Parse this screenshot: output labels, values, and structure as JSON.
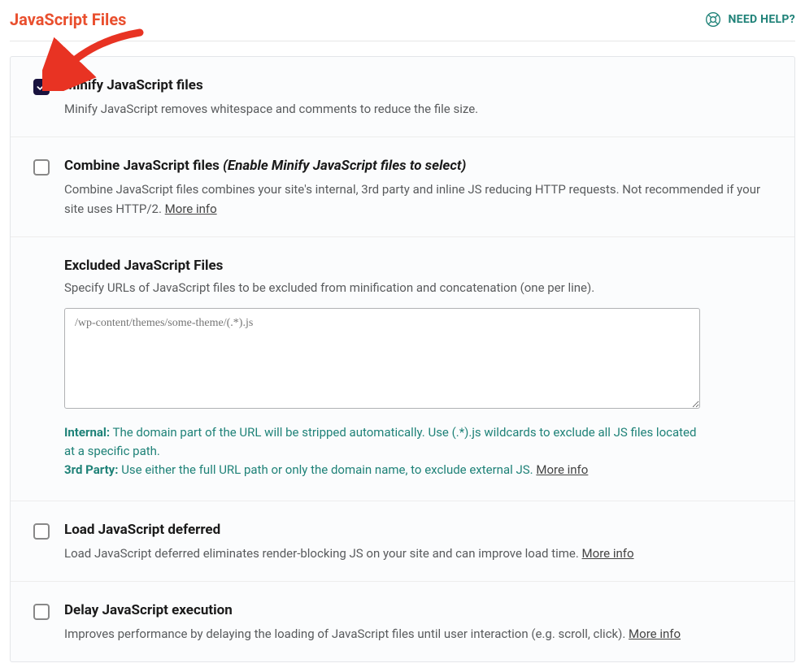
{
  "header": {
    "title": "JavaScript Files",
    "help_label": "NEED HELP?"
  },
  "options": {
    "minify": {
      "title": "Minify JavaScript files",
      "desc": "Minify JavaScript removes whitespace and comments to reduce the file size.",
      "checked": true
    },
    "combine": {
      "title": "Combine JavaScript files",
      "note": "(Enable Minify JavaScript files to select)",
      "desc": "Combine JavaScript files combines your site's internal, 3rd party and inline JS reducing HTTP requests. Not recommended if your site uses HTTP/2. ",
      "more": "More info",
      "checked": false
    },
    "excluded": {
      "title": "Excluded JavaScript Files",
      "desc": "Specify URLs of JavaScript files to be excluded from minification and concatenation (one per line).",
      "placeholder": "/wp-content/themes/some-theme/(.*).js",
      "hint_internal_label": "Internal:",
      "hint_internal_text": " The domain part of the URL will be stripped automatically. Use (.*).js wildcards to exclude all JS files located at a specific path.",
      "hint_3rdparty_label": "3rd Party:",
      "hint_3rdparty_text": " Use either the full URL path or only the domain name, to exclude external JS. ",
      "more": "More info"
    },
    "deferred": {
      "title": "Load JavaScript deferred",
      "desc": "Load JavaScript deferred eliminates render-blocking JS on your site and can improve load time. ",
      "more": "More info",
      "checked": false
    },
    "delay": {
      "title": "Delay JavaScript execution",
      "desc": "Improves performance by delaying the loading of JavaScript files until user interaction (e.g. scroll, click). ",
      "more": "More info",
      "checked": false
    }
  }
}
